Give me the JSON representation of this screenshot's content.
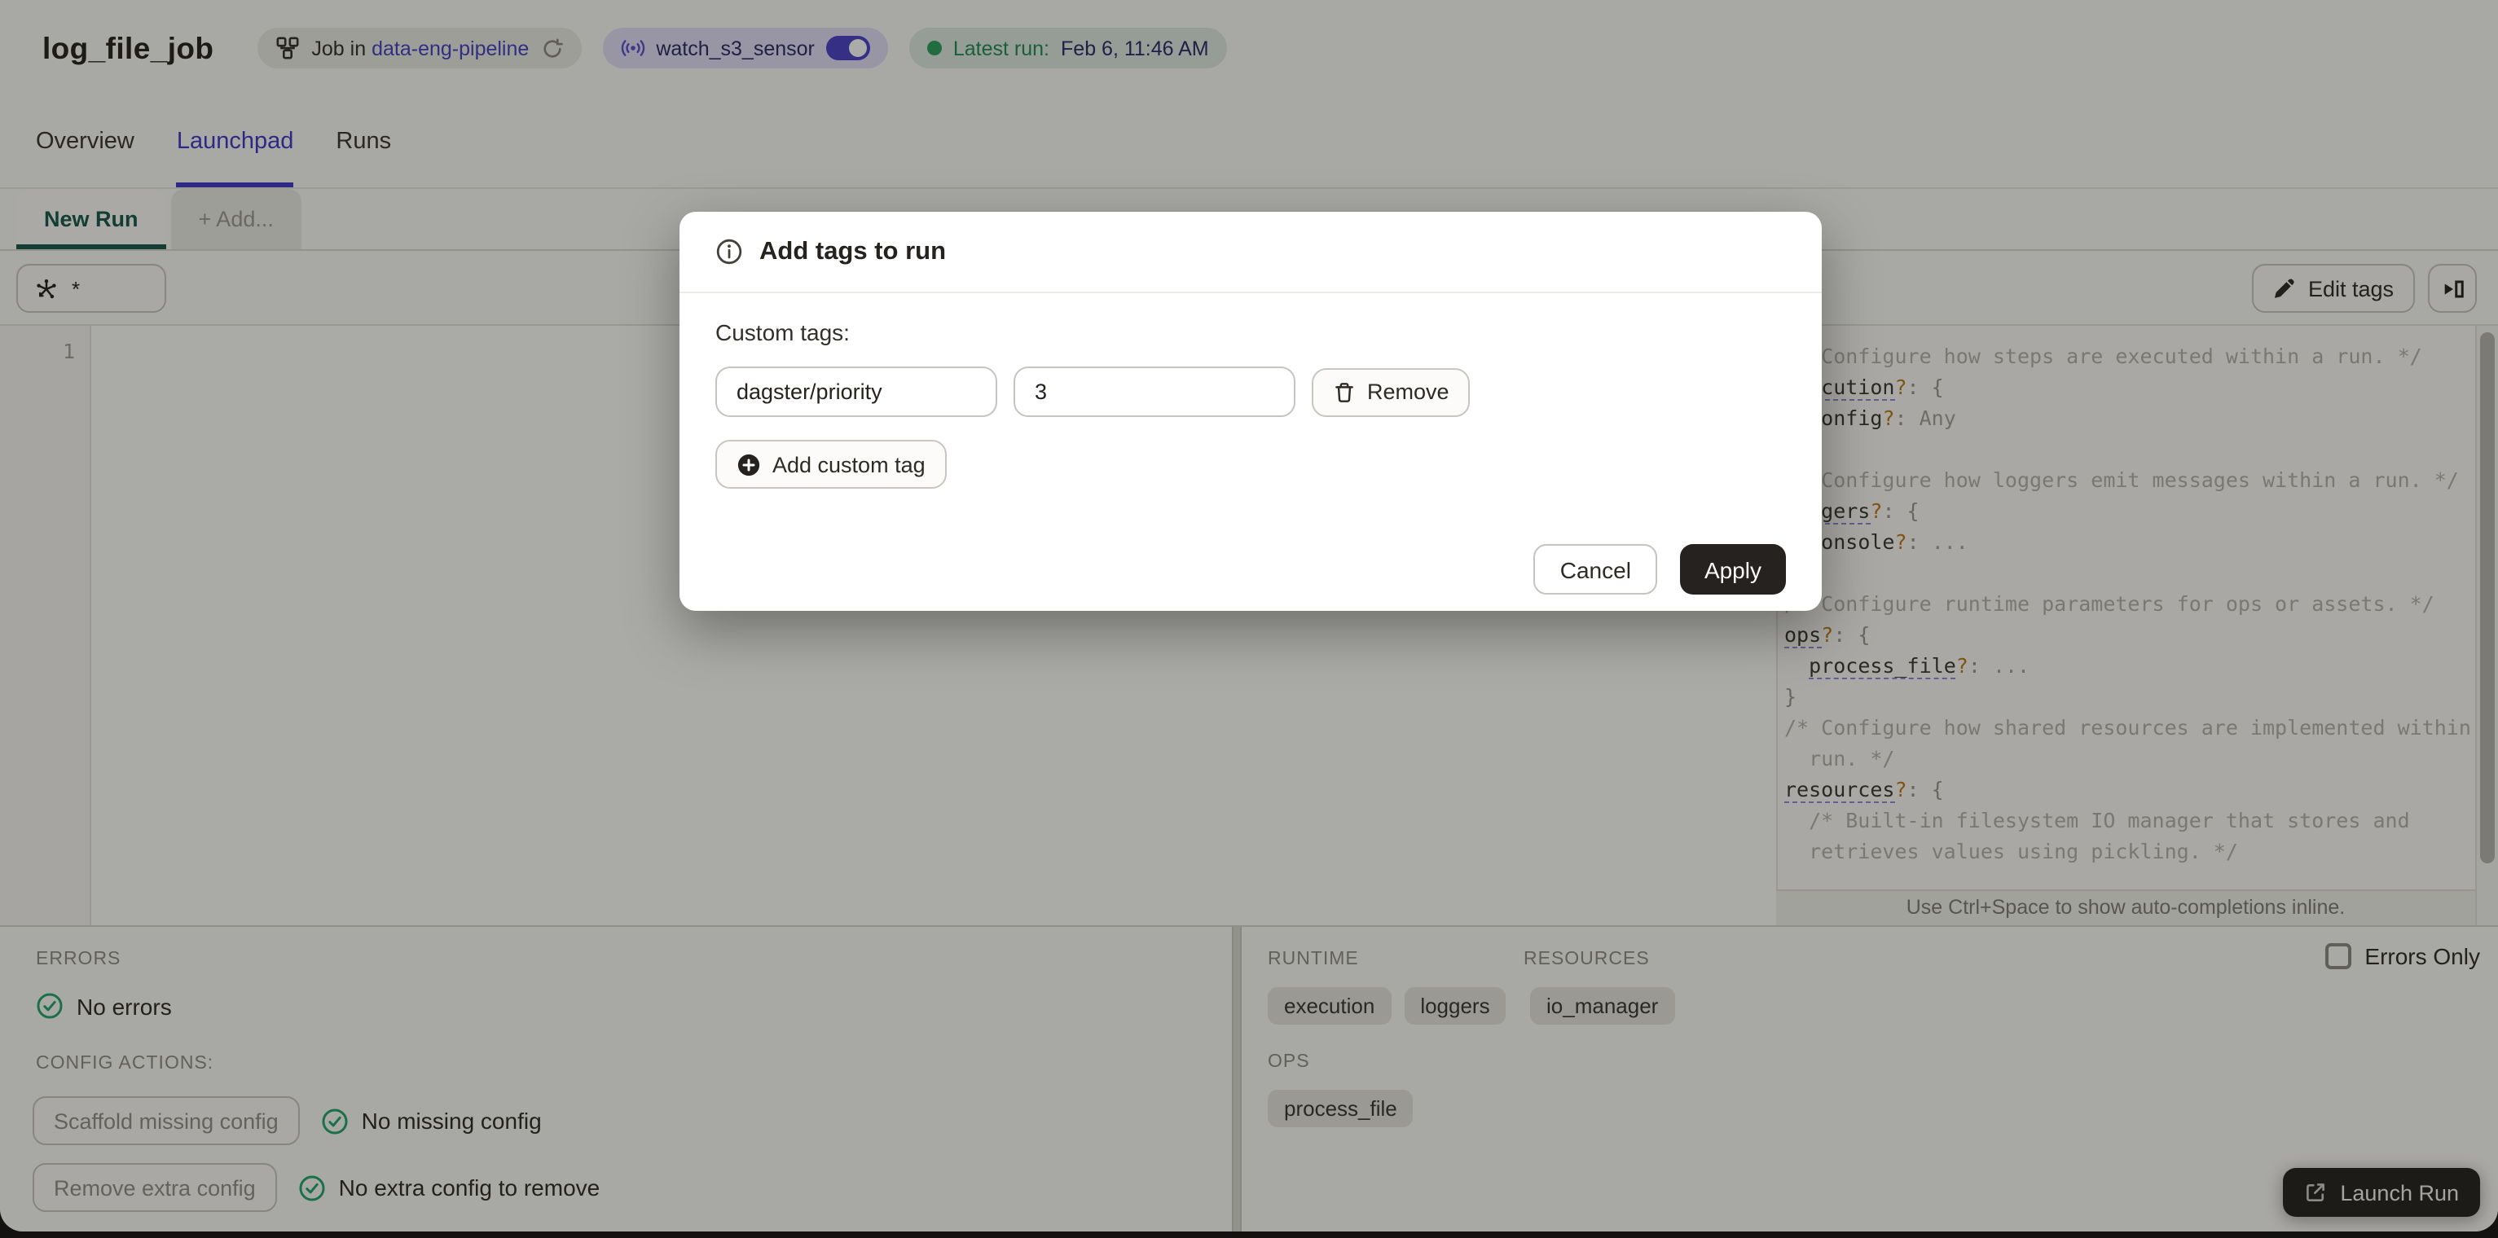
{
  "header": {
    "title": "log_file_job",
    "job_pill": {
      "prefix": "Job in",
      "link": "data-eng-pipeline"
    },
    "sensor_pill": {
      "label": "watch_s3_sensor"
    },
    "latest_run": {
      "label": "Latest run:",
      "value": "Feb 6, 11:46 AM"
    }
  },
  "tabs": [
    {
      "label": "Overview",
      "active": false
    },
    {
      "label": "Launchpad",
      "active": true
    },
    {
      "label": "Runs",
      "active": false
    }
  ],
  "launchpad": {
    "run_tabs": {
      "new_run": "New Run",
      "add": "+ Add..."
    },
    "op_selector": {
      "value": "*"
    },
    "edit_tags_label": "Edit tags",
    "editor": {
      "line_number": "1"
    },
    "hint": "Use Ctrl+Space to show auto-completions inline."
  },
  "code": {
    "lines": [
      [
        [
          "cm",
          "/* Configure how steps are executed within a run. */"
        ]
      ],
      [
        [
          "ku",
          "execution"
        ],
        [
          "q",
          "?"
        ],
        [
          "p",
          ": {"
        ]
      ],
      [
        [
          "p",
          "  "
        ],
        [
          "k",
          "config"
        ],
        [
          "q",
          "?"
        ],
        [
          "p",
          ": "
        ],
        [
          "v",
          "Any"
        ]
      ],
      [
        [
          "p",
          "}"
        ]
      ],
      [
        [
          "cm",
          "/* Configure how loggers emit messages within a run. */"
        ]
      ],
      [
        [
          "ku",
          "loggers"
        ],
        [
          "q",
          "?"
        ],
        [
          "p",
          ": {"
        ]
      ],
      [
        [
          "p",
          "  "
        ],
        [
          "k",
          "console"
        ],
        [
          "q",
          "?"
        ],
        [
          "p",
          ": "
        ],
        [
          "v",
          "..."
        ]
      ],
      [
        [
          "p",
          "}"
        ]
      ],
      [
        [
          "cm",
          "/* Configure runtime parameters for ops or assets. */"
        ]
      ],
      [
        [
          "ku",
          "ops"
        ],
        [
          "q",
          "?"
        ],
        [
          "p",
          ": {"
        ]
      ],
      [
        [
          "p",
          "  "
        ],
        [
          "ku",
          "process_file"
        ],
        [
          "q",
          "?"
        ],
        [
          "p",
          ": "
        ],
        [
          "v",
          "..."
        ]
      ],
      [
        [
          "p",
          "}"
        ]
      ],
      [
        [
          "cm",
          "/* Configure how shared resources are implemented within a"
        ]
      ],
      [
        [
          "cm",
          "  run. */"
        ]
      ],
      [
        [
          "ku",
          "resources"
        ],
        [
          "q",
          "?"
        ],
        [
          "p",
          ": {"
        ]
      ],
      [
        [
          "cm",
          "  /* Built-in filesystem IO manager that stores and"
        ]
      ],
      [
        [
          "cm",
          "  retrieves values using pickling. */"
        ]
      ]
    ]
  },
  "modal": {
    "title": "Add tags to run",
    "section_label": "Custom tags:",
    "tag_key": "dagster/priority",
    "tag_value": "3",
    "remove_label": "Remove",
    "add_label": "Add custom tag",
    "cancel_label": "Cancel",
    "apply_label": "Apply"
  },
  "bottom_left": {
    "errors_label": "ERRORS",
    "no_errors": "No errors",
    "config_actions_label": "CONFIG ACTIONS:",
    "scaffold_button": "Scaffold missing config",
    "no_missing": "No missing config",
    "remove_button": "Remove extra config",
    "no_extra": "No extra config to remove"
  },
  "bottom_right": {
    "runtime_label": "RUNTIME",
    "runtime_tags": [
      "execution",
      "loggers"
    ],
    "resources_label": "RESOURCES",
    "resources_tags": [
      "io_manager"
    ],
    "ops_label": "OPS",
    "ops_tags": [
      "process_file"
    ],
    "errors_only_label": "Errors Only"
  },
  "launch_button": "Launch Run",
  "colors": {
    "accent": "#4038C8",
    "active_tab_green": "#14584C",
    "status_green": "#2BA05F",
    "dark_button": "#262220",
    "code_question": "#BF7918"
  }
}
